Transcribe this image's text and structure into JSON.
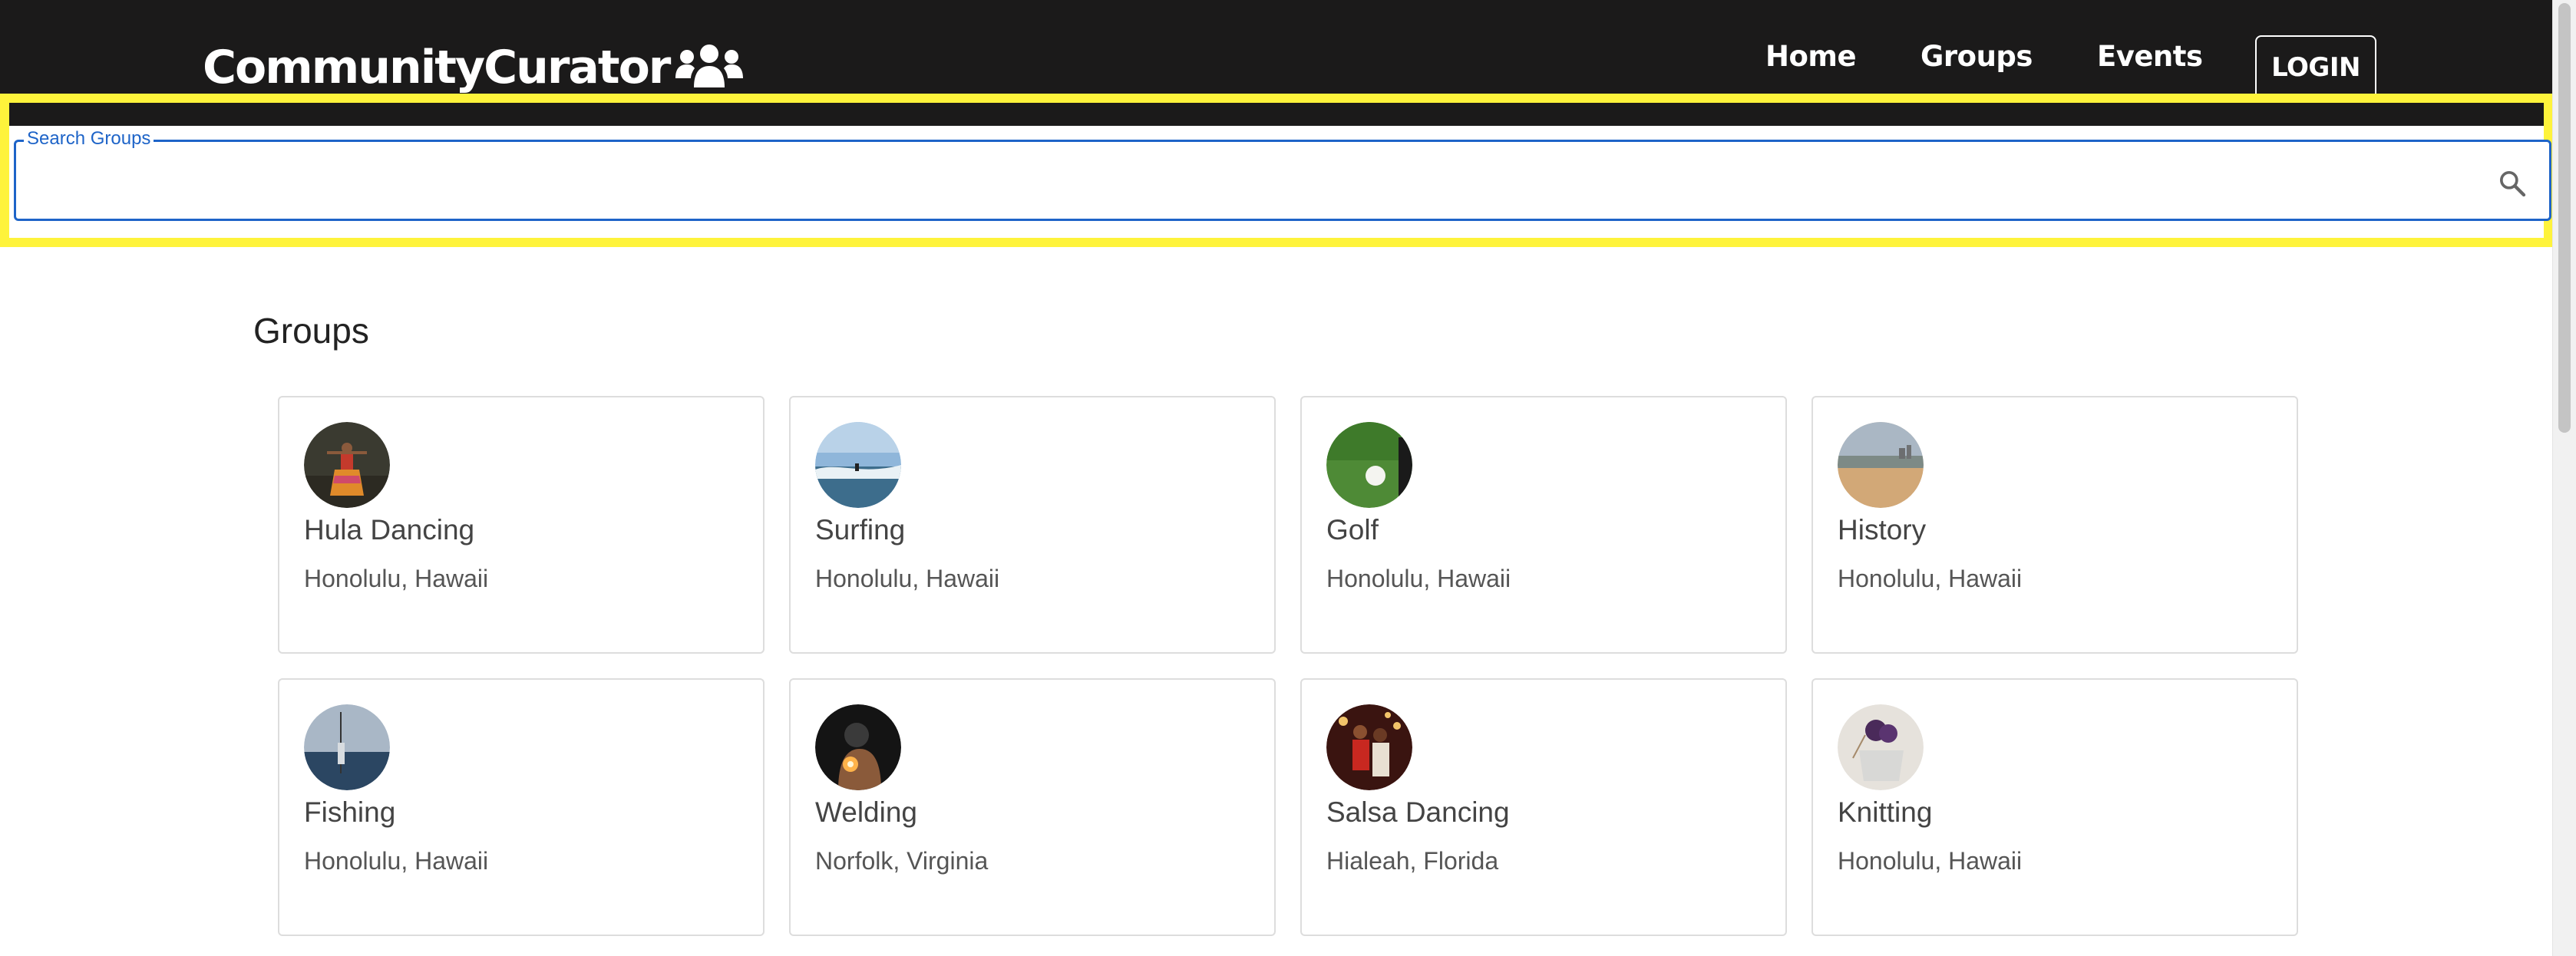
{
  "brand": {
    "name": "CommunityCurator",
    "icon": "people-group-icon"
  },
  "nav": {
    "links": [
      {
        "label": "Home"
      },
      {
        "label": "Groups"
      },
      {
        "label": "Events"
      }
    ],
    "login_label": "LOGIN"
  },
  "search": {
    "label": "Search Groups",
    "value": "",
    "icon": "search-icon"
  },
  "section": {
    "title": "Groups"
  },
  "groups": [
    {
      "name": "Hula Dancing",
      "location": "Honolulu, Hawaii"
    },
    {
      "name": "Surfing",
      "location": "Honolulu, Hawaii"
    },
    {
      "name": "Golf",
      "location": "Honolulu, Hawaii"
    },
    {
      "name": "History",
      "location": "Honolulu, Hawaii"
    },
    {
      "name": "Fishing",
      "location": "Honolulu, Hawaii"
    },
    {
      "name": "Welding",
      "location": "Norfolk, Virginia"
    },
    {
      "name": "Salsa Dancing",
      "location": "Hialeah, Florida"
    },
    {
      "name": "Knitting",
      "location": "Honolulu, Hawaii"
    }
  ],
  "colors": {
    "navbar": "#1b1a1a",
    "highlight": "#fef33b",
    "accent": "#1e64c8"
  }
}
